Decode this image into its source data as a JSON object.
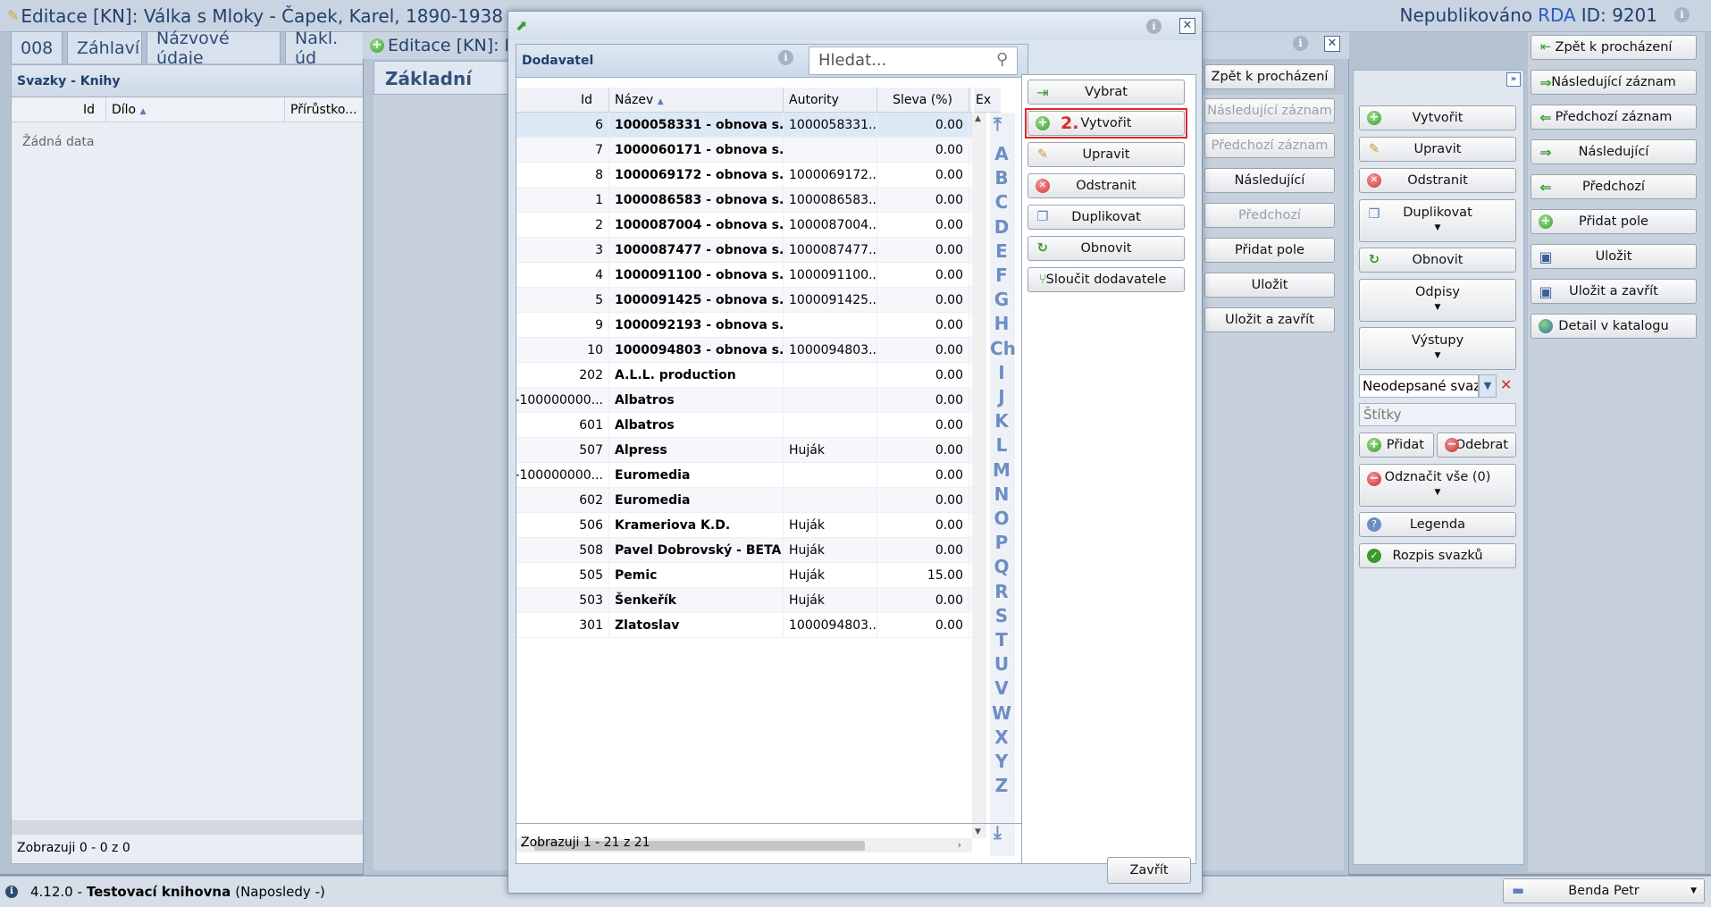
{
  "main_window": {
    "title": "Editace [KN]: Válka s Mloky - Čapek, Karel, 1890-1938",
    "status": "Nepublikováno",
    "rda_label": "RDA",
    "id_label": "ID: 9201",
    "tabs": [
      "008",
      "Záhlaví",
      "Názvové údaje",
      "Nakl. úd"
    ]
  },
  "left_panel": {
    "title": "Svazky - Knihy",
    "columns": [
      "Id",
      "Dílo",
      "Přírůstko..."
    ],
    "empty_text": "Žádná data",
    "footer": "Zobrazuji 0 - 0 z 0"
  },
  "second_window": {
    "title": "Editace [KN]: N",
    "tab": "Základní infor"
  },
  "second_buttons": [
    "Zpět k procházení",
    "Následující záznam",
    "Předchozí záznam",
    "Následující",
    "Předchozí",
    "Přidat pole",
    "Uložit",
    "Uložit a zavřít"
  ],
  "mid_panel": {
    "buttons": [
      "Vytvořit",
      "Upravit",
      "Odstranit",
      "Duplikovat",
      "Obnovit",
      "Odpisy",
      "Výstupy"
    ],
    "combo_value": "Neodepsané svazl",
    "tags_placeholder": "Štítky",
    "add_label": "Přidat",
    "remove_label": "Odebrat",
    "unmark_label": "Odznačit vše (0)",
    "legend_label": "Legenda",
    "breakdown_label": "Rozpis svazků"
  },
  "right_panel": {
    "buttons": [
      "Zpět k procházení",
      "Následující záznam",
      "Předchozí záznam",
      "Následující",
      "Předchozí",
      "Přidat pole",
      "Uložit",
      "Uložit a zavřít",
      "Detail v katalogu"
    ]
  },
  "dialog": {
    "panel_title": "Dodavatel",
    "search_placeholder": "Hledat...",
    "columns": [
      "Id",
      "Název",
      "Autority",
      "Sleva (%)",
      "Ex"
    ],
    "rows": [
      {
        "id": "6",
        "name": "1000058331 - obnova s...",
        "auth": "1000058331...",
        "disc": "0.00"
      },
      {
        "id": "7",
        "name": "1000060171 - obnova s...",
        "auth": "",
        "disc": "0.00"
      },
      {
        "id": "8",
        "name": "1000069172 - obnova s...",
        "auth": "1000069172...",
        "disc": "0.00"
      },
      {
        "id": "1",
        "name": "1000086583 - obnova s...",
        "auth": "1000086583...",
        "disc": "0.00"
      },
      {
        "id": "2",
        "name": "1000087004 - obnova s...",
        "auth": "1000087004...",
        "disc": "0.00"
      },
      {
        "id": "3",
        "name": "1000087477 - obnova s...",
        "auth": "1000087477...",
        "disc": "0.00"
      },
      {
        "id": "4",
        "name": "1000091100 - obnova s...",
        "auth": "1000091100...",
        "disc": "0.00"
      },
      {
        "id": "5",
        "name": "1000091425 - obnova s...",
        "auth": "1000091425...",
        "disc": "0.00"
      },
      {
        "id": "9",
        "name": "1000092193 - obnova s...",
        "auth": "",
        "disc": "0.00"
      },
      {
        "id": "10",
        "name": "1000094803 - obnova s...",
        "auth": "1000094803...",
        "disc": "0.00"
      },
      {
        "id": "202",
        "name": "A.L.L. production",
        "auth": "",
        "disc": "0.00"
      },
      {
        "id": "-100000000...",
        "name": "Albatros",
        "auth": "",
        "disc": "0.00"
      },
      {
        "id": "601",
        "name": "Albatros",
        "auth": "",
        "disc": "0.00"
      },
      {
        "id": "507",
        "name": "Alpress",
        "auth": "Huják",
        "disc": "0.00"
      },
      {
        "id": "-100000000...",
        "name": "Euromedia",
        "auth": "",
        "disc": "0.00"
      },
      {
        "id": "602",
        "name": "Euromedia",
        "auth": "",
        "disc": "0.00"
      },
      {
        "id": "506",
        "name": "Krameriova K.D.",
        "auth": "Huják",
        "disc": "0.00"
      },
      {
        "id": "508",
        "name": "Pavel Dobrovský - BETA ...",
        "auth": "Huják",
        "disc": "0.00"
      },
      {
        "id": "505",
        "name": "Pemic",
        "auth": "Huják",
        "disc": "15.00"
      },
      {
        "id": "503",
        "name": "Šenkeřík",
        "auth": "Huják",
        "disc": "0.00"
      },
      {
        "id": "301",
        "name": "Zlatoslav",
        "auth": "1000094803...",
        "disc": "0.00"
      }
    ],
    "letters": [
      "A",
      "B",
      "C",
      "D",
      "E",
      "F",
      "G",
      "H",
      "Ch",
      "I",
      "J",
      "K",
      "L",
      "M",
      "N",
      "O",
      "P",
      "Q",
      "R",
      "S",
      "T",
      "U",
      "V",
      "W",
      "X",
      "Y",
      "Z"
    ],
    "footer": "Zobrazuji 1 - 21 z 21",
    "actions": [
      "Vybrat",
      "Vytvořit",
      "Upravit",
      "Odstranit",
      "Duplikovat",
      "Obnovit",
      "Sloučit dodavatele"
    ],
    "step_marker": "2.",
    "close_label": "Zavřít"
  },
  "status_bar": {
    "version": "4.12.0 -",
    "library": "Testovací knihovna",
    "last_login": "(Naposledy -)",
    "user": "Benda Petr"
  }
}
